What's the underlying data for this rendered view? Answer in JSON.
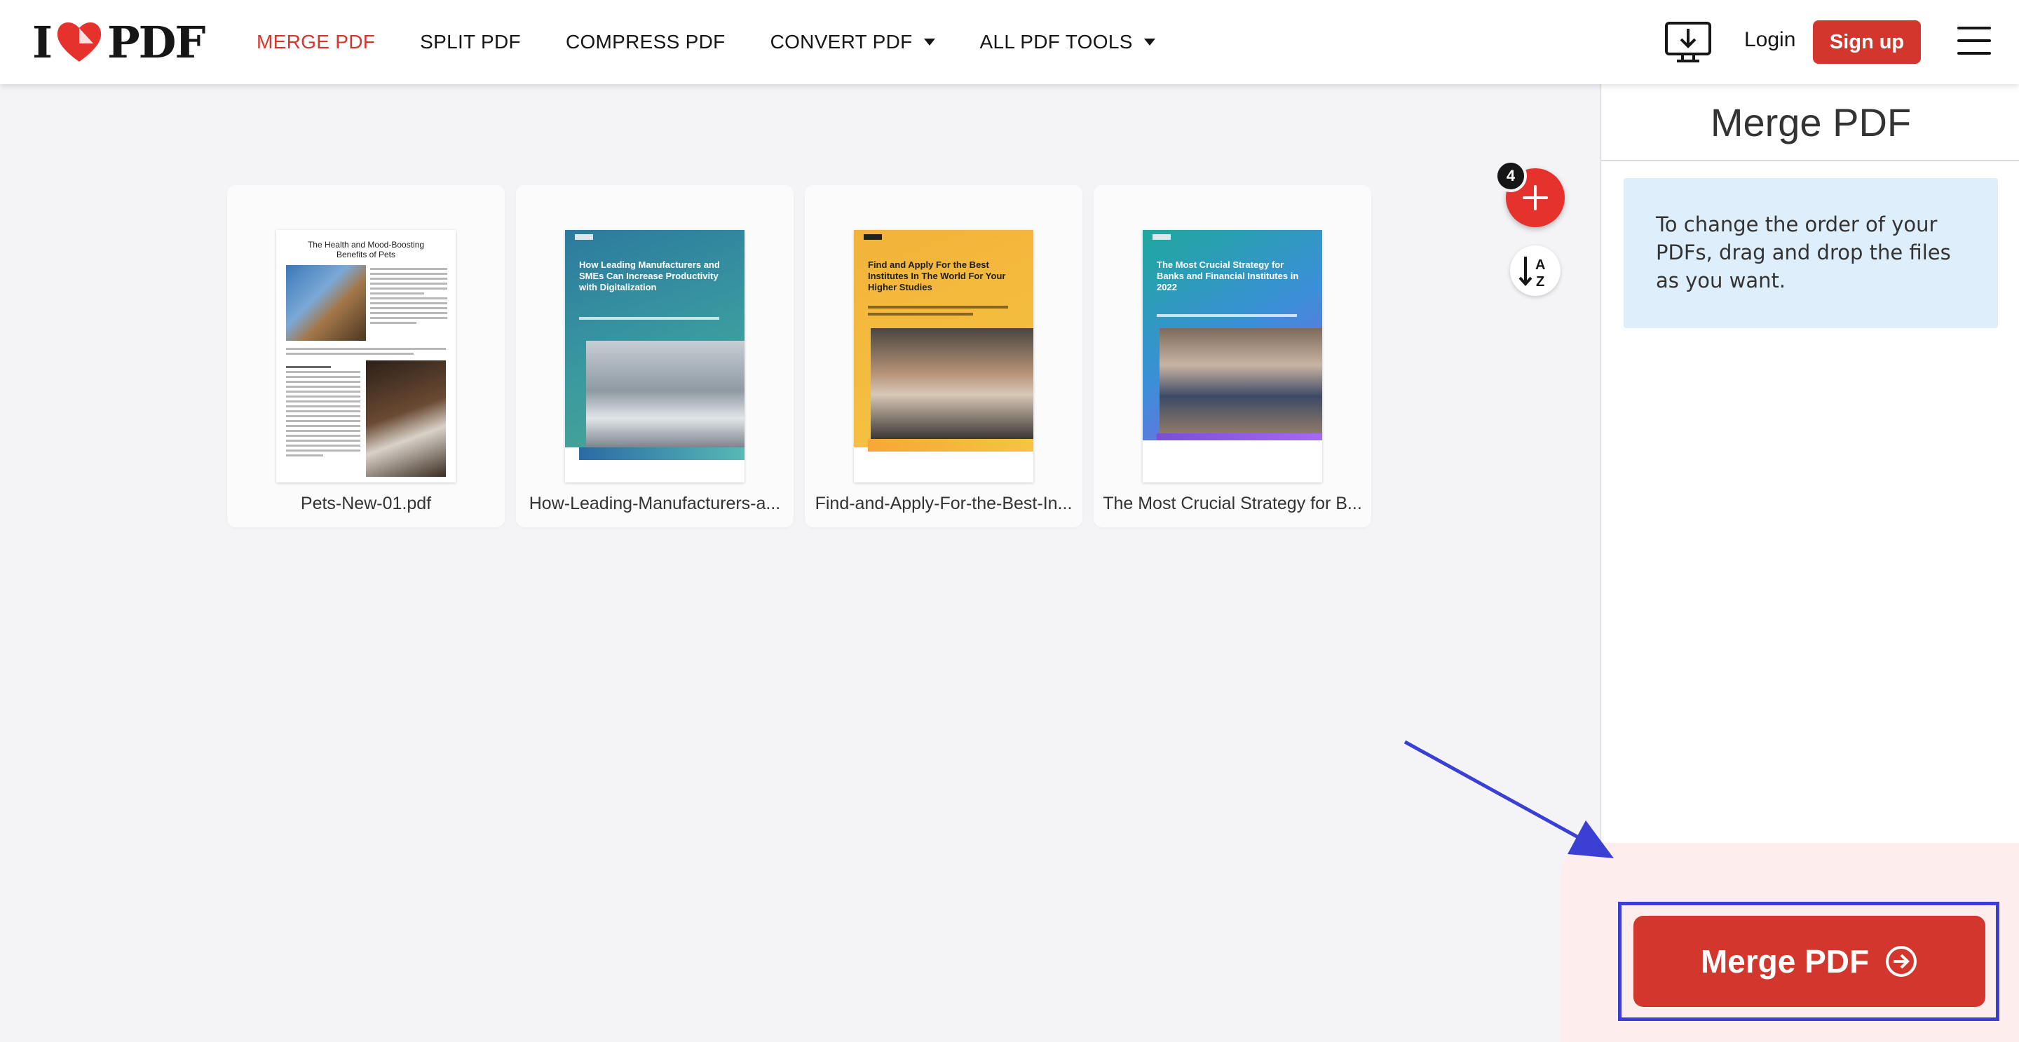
{
  "header": {
    "logo_left": "I",
    "logo_right": "PDF",
    "nav": [
      {
        "label": "MERGE PDF",
        "active": true
      },
      {
        "label": "SPLIT PDF"
      },
      {
        "label": "COMPRESS PDF"
      },
      {
        "label": "CONVERT PDF",
        "dropdown": true
      },
      {
        "label": "ALL PDF TOOLS",
        "dropdown": true
      }
    ],
    "login_label": "Login",
    "signup_label": "Sign up",
    "brand_color": "#d3362d"
  },
  "files": {
    "count": "4",
    "items": [
      {
        "name": "Pets-New-01.pdf",
        "cover_title": "The Health and Mood-Boosting Benefits of Pets"
      },
      {
        "name": "How-Leading-Manufacturers-a...",
        "cover_title": "How Leading Manufacturers and SMEs Can Increase Productivity with Digitalization"
      },
      {
        "name": "Find-and-Apply-For-the-Best-In...",
        "cover_title": "Find and Apply For the Best Institutes In The World For Your Higher Studies"
      },
      {
        "name": "The Most Crucial Strategy for B...",
        "cover_title": "The Most Crucial Strategy for Banks and Financial Institutes in 2022"
      }
    ]
  },
  "panel": {
    "title": "Merge PDF",
    "info_text": "To change the order of your PDFs, drag and drop the files as you want.",
    "action_label": "Merge PDF"
  },
  "annotation": {
    "color": "#3b3fd4"
  }
}
